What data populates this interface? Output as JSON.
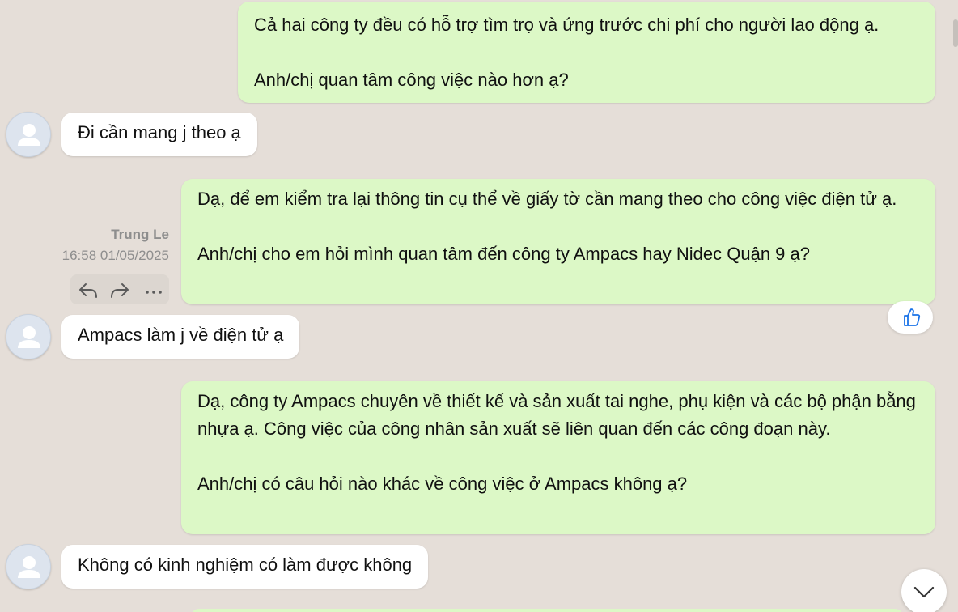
{
  "messages": [
    {
      "direction": "out",
      "text": "Cả hai công ty đều có hỗ trợ tìm trọ và ứng trước chi phí cho người lao động ạ.\n\nAnh/chị quan tâm công việc nào hơn ạ?"
    },
    {
      "direction": "in",
      "text": "Đi cần mang j theo ạ"
    },
    {
      "direction": "out",
      "text": "Dạ, để em kiểm tra lại thông tin cụ thể về giấy tờ cần mang theo cho công việc điện tử ạ.\n\nAnh/chị cho em hỏi mình quan tâm đến công ty Ampacs hay Nidec Quận 9 ạ?",
      "sender": "Trung Le",
      "time": "16:58 01/05/2025",
      "reaction": "thumbs-up"
    },
    {
      "direction": "in",
      "text": "Ampacs làm j về điện tử ạ"
    },
    {
      "direction": "out",
      "text": "Dạ, công ty Ampacs chuyên về thiết kế và sản xuất tai nghe, phụ kiện và các bộ phận bằng nhựa ạ. Công việc của công nhân sản xuất sẽ liên quan đến các công đoạn này.\n\nAnh/chị có câu hỏi nào khác về công việc ở Ampacs không ạ?"
    },
    {
      "direction": "in",
      "text": "Không có kinh nghiệm có làm được không"
    }
  ],
  "actions": {
    "reply_icon": "reply-icon",
    "forward_icon": "forward-icon",
    "more_icon": "more-icon"
  },
  "reaction_icon": "thumbs-up-icon",
  "scroll_icon": "chevron-down-icon",
  "colors": {
    "background": "#e5ded8",
    "outgoing_bubble": "#dcf8c6",
    "incoming_bubble": "#ffffff",
    "meta_text": "#8e8e8e",
    "accent": "#1a73e8"
  }
}
